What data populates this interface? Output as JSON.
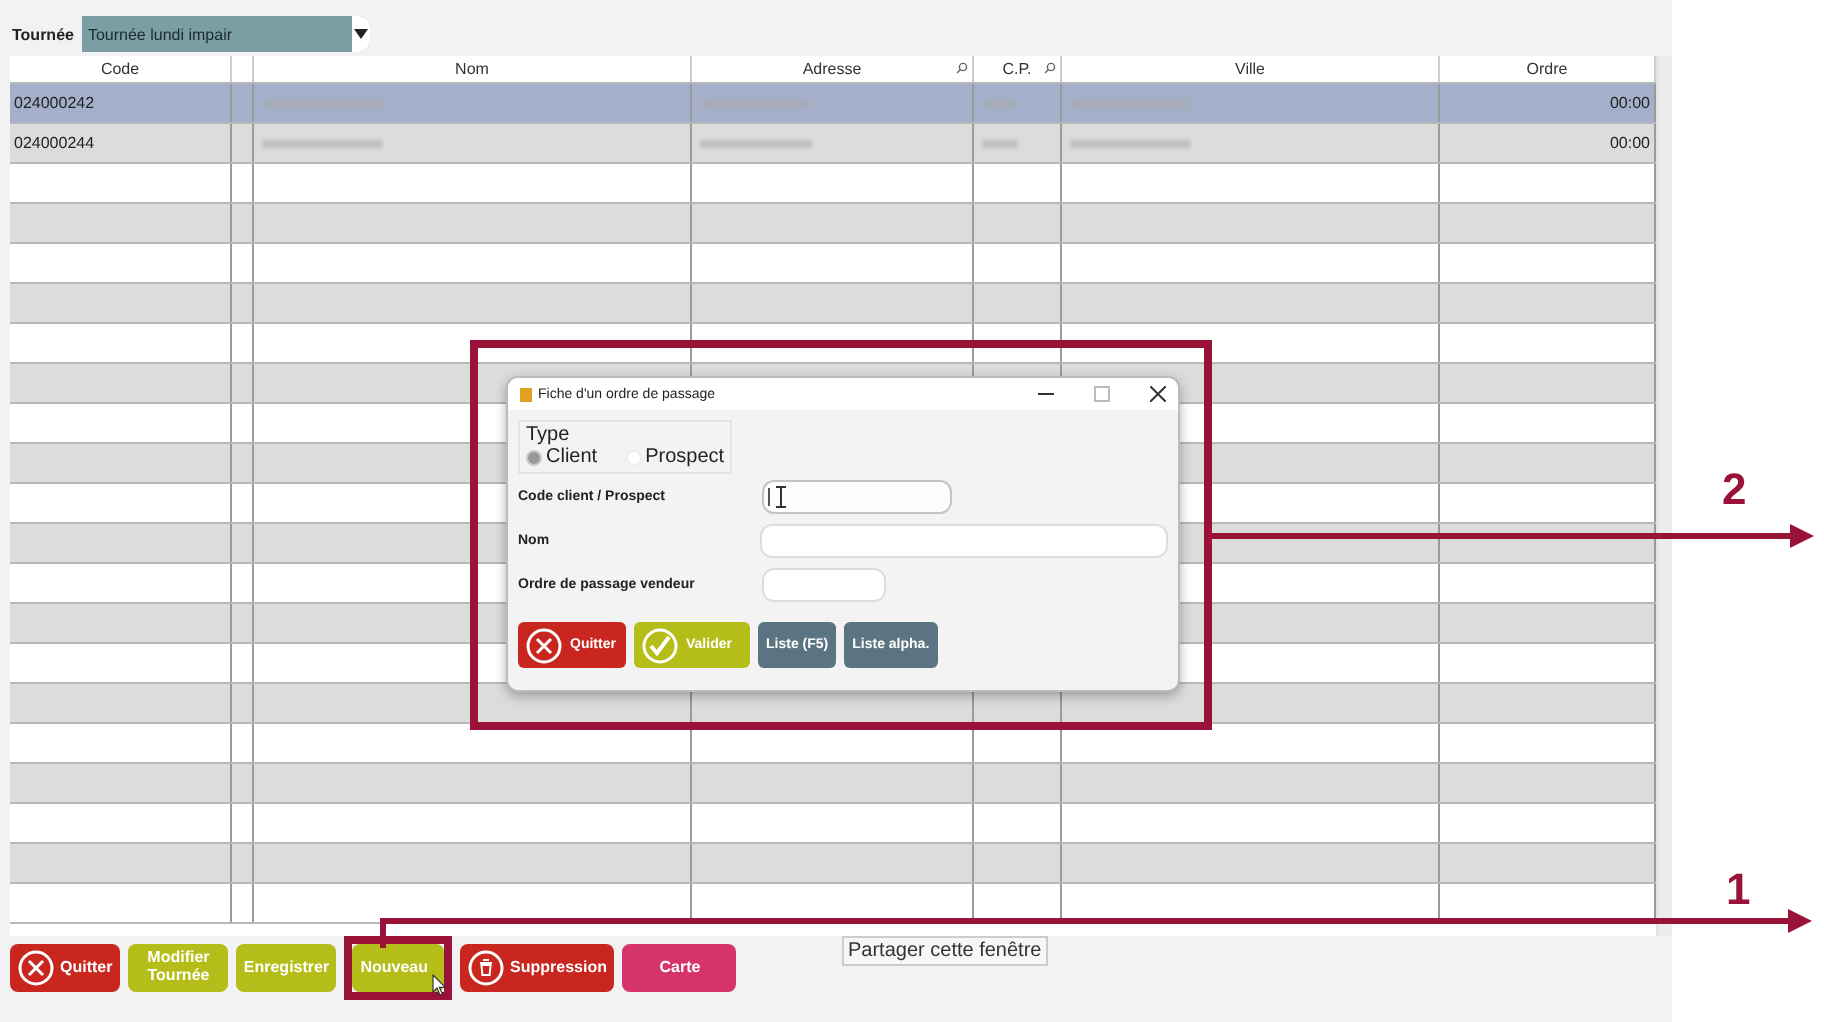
{
  "filter": {
    "label": "Tournée",
    "value": "Tournée lundi impair"
  },
  "table": {
    "columns": [
      {
        "kind": "text",
        "label": "Code",
        "searchable": false
      },
      {
        "kind": "spacer"
      },
      {
        "kind": "text",
        "label": "Nom",
        "searchable": false
      },
      {
        "kind": "text",
        "label": "Adresse",
        "searchable": true
      },
      {
        "kind": "text",
        "label": "C.P.",
        "searchable": true
      },
      {
        "kind": "text",
        "label": "Ville",
        "searchable": false
      },
      {
        "kind": "text",
        "label": "Ordre",
        "searchable": false
      }
    ],
    "rows": [
      {
        "code": "024000242",
        "ordre": "00:00",
        "selected": true
      },
      {
        "code": "024000244",
        "ordre": "00:00",
        "selected": false
      }
    ]
  },
  "dialog": {
    "title": "Fiche d'un ordre de passage",
    "type_label": "Type",
    "options": [
      {
        "label": "Client",
        "selected": true
      },
      {
        "label": "Prospect",
        "selected": false
      }
    ],
    "fields": [
      {
        "label": "Code client / Prospect",
        "focused": true
      },
      {
        "label": "Nom",
        "focused": false
      },
      {
        "label": "Ordre de passage vendeur",
        "focused": false
      }
    ],
    "buttons": [
      {
        "label": "Quitter",
        "kind": "quit"
      },
      {
        "label": "Valider",
        "kind": "validate"
      },
      {
        "label": "Liste (F5)",
        "kind": "list"
      },
      {
        "label": "Liste alpha.",
        "kind": "list"
      }
    ]
  },
  "toolbar": [
    {
      "label": "Quitter",
      "kind": "quit",
      "highlighted": false
    },
    {
      "label": "Modifier Tournée",
      "kind": "action",
      "highlighted": false
    },
    {
      "label": "Enregistrer",
      "kind": "action",
      "highlighted": false
    },
    {
      "label": "Nouveau",
      "kind": "action",
      "highlighted": true
    },
    {
      "label": "Suppression",
      "kind": "delete",
      "highlighted": false
    },
    {
      "label": "Carte",
      "kind": "map",
      "highlighted": false
    }
  ],
  "tooltip": "Partager cette fenêtre",
  "annotations": [
    {
      "label": "2"
    },
    {
      "label": "1"
    }
  ]
}
